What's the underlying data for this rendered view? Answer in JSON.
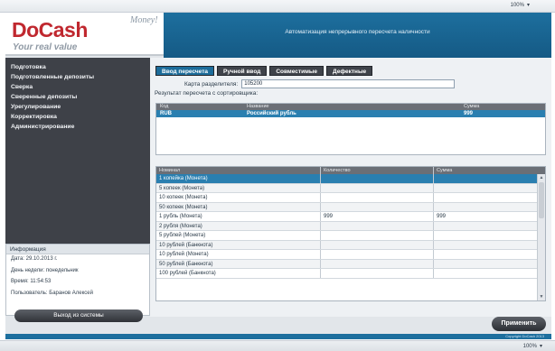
{
  "browser": {
    "zoom_top": "100%",
    "zoom_bottom": "100%",
    "caret": "▾"
  },
  "logo": {
    "main": "DoCash",
    "money": "Money!",
    "tagline": "Your real value"
  },
  "header": {
    "title": "Автоматизация непрерывного пересчета наличности"
  },
  "sidebar": {
    "items": [
      {
        "label": "Подготовка"
      },
      {
        "label": "Подготовленные депозиты"
      },
      {
        "label": "Сверка"
      },
      {
        "label": "Сверенные депозиты"
      },
      {
        "label": "Урегулирование"
      },
      {
        "label": "Корректировка"
      },
      {
        "label": "Администрирование"
      }
    ]
  },
  "info": {
    "title": "Информация",
    "date": "Дата: 29.10.2013 г.",
    "day": "День недели: понедельник",
    "time": "Время: 11:54:53",
    "user": "Пользователь: Баранов Алексей"
  },
  "logout_label": "Выход из системы",
  "tabs": [
    {
      "label": "Ввод пересчета",
      "active": true
    },
    {
      "label": "Ручной ввод",
      "active": false
    },
    {
      "label": "Совместимые",
      "active": false
    },
    {
      "label": "Дефектные",
      "active": false
    }
  ],
  "card": {
    "label": "Карта разделителя:",
    "value": "105200"
  },
  "result_label": "Результат пересчета с сортировщика:",
  "table1": {
    "headers": [
      "Код",
      "Название",
      "Сумма"
    ],
    "rows": [
      [
        "RUB",
        "Российский рубль",
        "999"
      ]
    ]
  },
  "table2": {
    "headers": [
      "Номинал",
      "Количество",
      "Сумма"
    ],
    "rows": [
      [
        "1 копейка (Монета)",
        "",
        ""
      ],
      [
        "5 копеек (Монета)",
        "",
        ""
      ],
      [
        "10 копеек (Монета)",
        "",
        ""
      ],
      [
        "50 копеек (Монета)",
        "",
        ""
      ],
      [
        "1 рубль (Монета)",
        "999",
        "999"
      ],
      [
        "2 рубля (Монета)",
        "",
        ""
      ],
      [
        "5 рублей (Монета)",
        "",
        ""
      ],
      [
        "10 рублей (Банкнота)",
        "",
        ""
      ],
      [
        "10 рублей (Монета)",
        "",
        ""
      ],
      [
        "50 рублей (Банкнота)",
        "",
        ""
      ],
      [
        "100 рублей (Банкнота)",
        "",
        ""
      ]
    ],
    "selected_row": 0
  },
  "scroll": {
    "up": "▲",
    "down": "▼"
  },
  "apply_label": "Применить",
  "footer_text": "Copyright DoCash 2013"
}
